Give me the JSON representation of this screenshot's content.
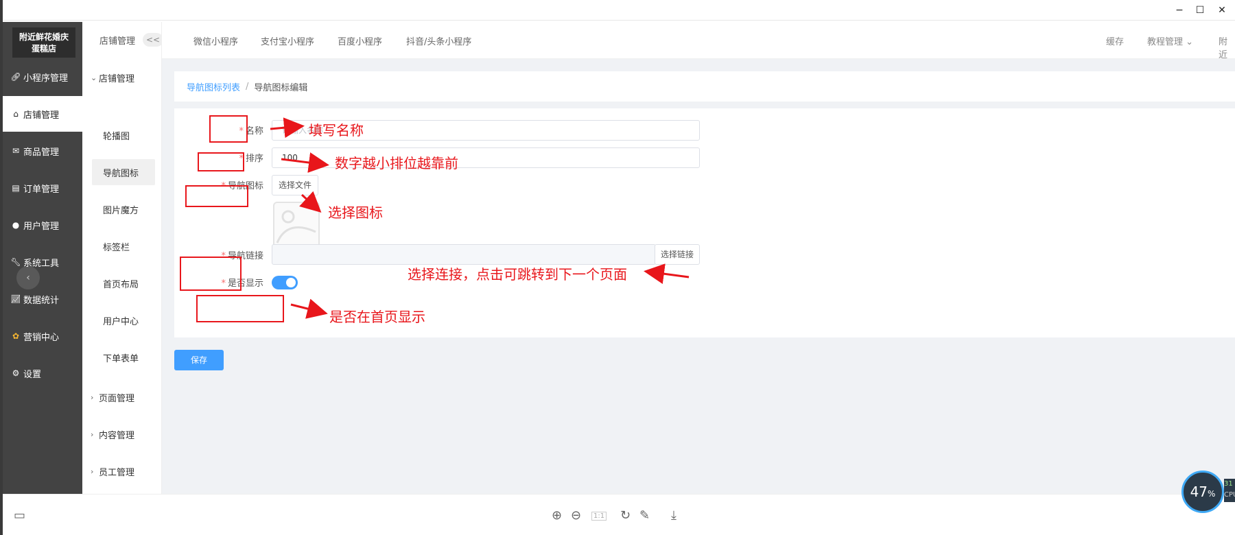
{
  "window": {
    "minimize": "−",
    "maximize": "☐",
    "close": "✕"
  },
  "sidebar": {
    "shop_name_line1": "附近鲜花婚庆",
    "shop_name_line2": "蛋糕店",
    "items": [
      {
        "label": "小程序管理",
        "icon": "link-icon"
      },
      {
        "label": "店铺管理",
        "icon": "store-icon"
      },
      {
        "label": "商品管理",
        "icon": "goods-icon"
      },
      {
        "label": "订单管理",
        "icon": "order-icon"
      },
      {
        "label": "用户管理",
        "icon": "user-icon"
      },
      {
        "label": "系统工具",
        "icon": "wrench-icon"
      },
      {
        "label": "数据统计",
        "icon": "chart-icon"
      },
      {
        "label": "营销中心",
        "icon": "marketing-icon"
      },
      {
        "label": "设置",
        "icon": "settings-icon"
      }
    ],
    "collapse": "‹"
  },
  "subnav": {
    "header": "店铺管理",
    "toggle": "<<",
    "group_open": "店铺管理",
    "items": [
      "轮播图",
      "导航图标",
      "图片魔方",
      "标签栏",
      "首页布局",
      "用户中心",
      "下单表单"
    ],
    "groups": [
      "页面管理",
      "内容管理",
      "员工管理"
    ]
  },
  "topbar": {
    "tabs": [
      "微信小程序",
      "支付宝小程序",
      "百度小程序",
      "抖音/头条小程序"
    ],
    "right": {
      "cache": "缓存",
      "tutorial": "教程管理",
      "more": "附近"
    }
  },
  "breadcrumb": {
    "parent": "导航图标列表",
    "separator": "/",
    "current": "导航图标编辑"
  },
  "form": {
    "required_mark": "*",
    "name": {
      "label": "名称",
      "placeholder": "请输入名称"
    },
    "sort": {
      "label": "排序",
      "value": "100"
    },
    "icon": {
      "label": "导航图标",
      "button": "选择文件"
    },
    "link": {
      "label": "导航链接",
      "value": "",
      "button": "选择链接"
    },
    "show": {
      "label": "是否显示",
      "enabled": true
    }
  },
  "save_button": "保存",
  "annotations": {
    "name": "填写名称",
    "sort": "数字越小排位越靠前",
    "icon": "选择图标",
    "link": "选择连接，点击可跳转到下一个页面",
    "show": "是否在首页显示"
  },
  "viewer": {
    "zoom_in": "⊕",
    "zoom_out": "⊖",
    "actual_size": "1:1",
    "rotate": "↻",
    "edit": "✎",
    "download": "⤓",
    "layout": "▭"
  },
  "cpu": {
    "percent": "47",
    "unit": "%",
    "side_value": "31",
    "side_label": "CPU"
  },
  "colors": {
    "accent": "#409eff",
    "annotation": "#e8161b",
    "sidebar": "#434343"
  }
}
